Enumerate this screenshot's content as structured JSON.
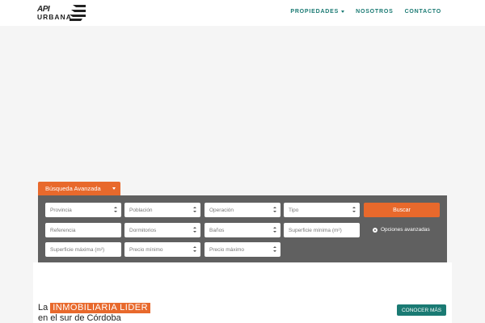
{
  "logo": {
    "line1": "API",
    "line2": "URBANA"
  },
  "nav": {
    "items": [
      {
        "label": "PROPIEDADES",
        "has_dropdown": true
      },
      {
        "label": "NOSOTROS",
        "has_dropdown": false
      },
      {
        "label": "CONTACTO",
        "has_dropdown": false
      }
    ]
  },
  "search": {
    "tab_label": "Búsqueda Avanzada",
    "row1": {
      "provincia": "Provincia",
      "poblacion": "Población",
      "operacion": "Operación",
      "tipo": "Tipo"
    },
    "row2": {
      "referencia": "Referencia",
      "dormitorios": "Dormitorios",
      "banos": "Baños",
      "superficie_minima": "Superficie mínima (m²)"
    },
    "row3": {
      "superficie_maxima": "Superficie máxima (m²)",
      "precio_minimo": "Precio mínimo",
      "precio_maximo": "Precio máximo"
    },
    "buscar_label": "Buscar",
    "advanced_label": "Opciones avanzadas"
  },
  "content": {
    "headline_prefix": "La",
    "headline_highlight": "INMOBILIARIA LIDER",
    "headline_line2": "en el sur de Córdoba",
    "cta_label": "CONOCER MÁS"
  },
  "colors": {
    "accent_orange": "#e8692c",
    "accent_teal": "#1a7a73",
    "panel_gray": "#606060"
  }
}
